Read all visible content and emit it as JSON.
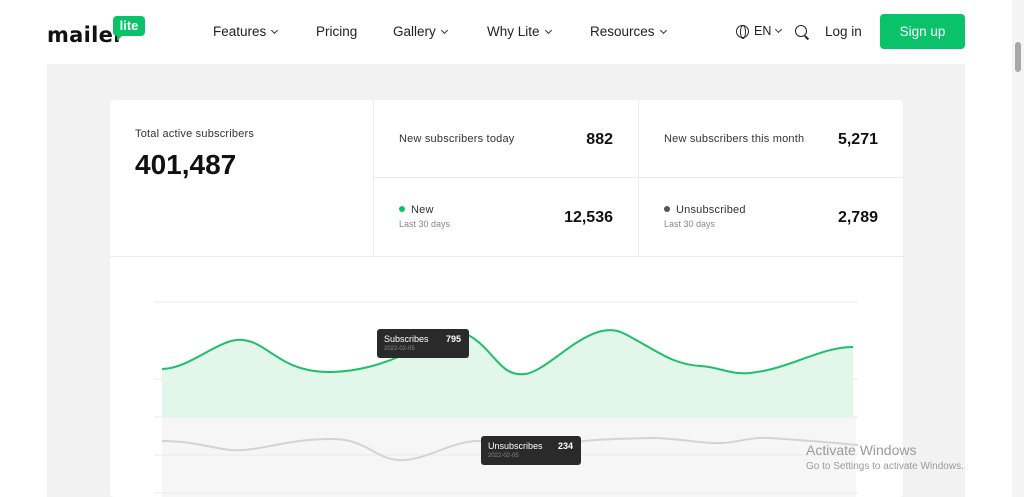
{
  "nav": {
    "logo_word": "mailer",
    "logo_badge": "lite",
    "items": [
      {
        "label": "Features",
        "dropdown": true
      },
      {
        "label": "Pricing",
        "dropdown": false
      },
      {
        "label": "Gallery",
        "dropdown": true
      },
      {
        "label": "Why Lite",
        "dropdown": true
      },
      {
        "label": "Resources",
        "dropdown": true
      }
    ],
    "language": "EN",
    "login": "Log in",
    "signup": "Sign up"
  },
  "stats": {
    "total": {
      "label": "Total active subscribers",
      "value": "401,487"
    },
    "today": {
      "label": "New subscribers today",
      "value": "882"
    },
    "month": {
      "label": "New subscribers this month",
      "value": "5,271"
    },
    "new": {
      "label": "New",
      "sub": "Last 30 days",
      "value": "12,536"
    },
    "unsub": {
      "label": "Unsubscribed",
      "sub": "Last 30 days",
      "value": "2,789"
    }
  },
  "tooltips": {
    "subscribes": {
      "label": "Subscribes",
      "value": "795",
      "date": "2022-02-05"
    },
    "unsubscribes": {
      "label": "Unsubscribes",
      "value": "234",
      "date": "2022-02-05"
    }
  },
  "colors": {
    "accent": "#09c269",
    "subscribes_line": "#1fbf6a",
    "subscribes_fill": "#e3f6ea",
    "unsubscribes_line": "#d3d3d6",
    "unsub_dot": "#555555"
  },
  "watermark": {
    "title": "Activate Windows",
    "subtitle": "Go to Settings to activate Windows."
  }
}
